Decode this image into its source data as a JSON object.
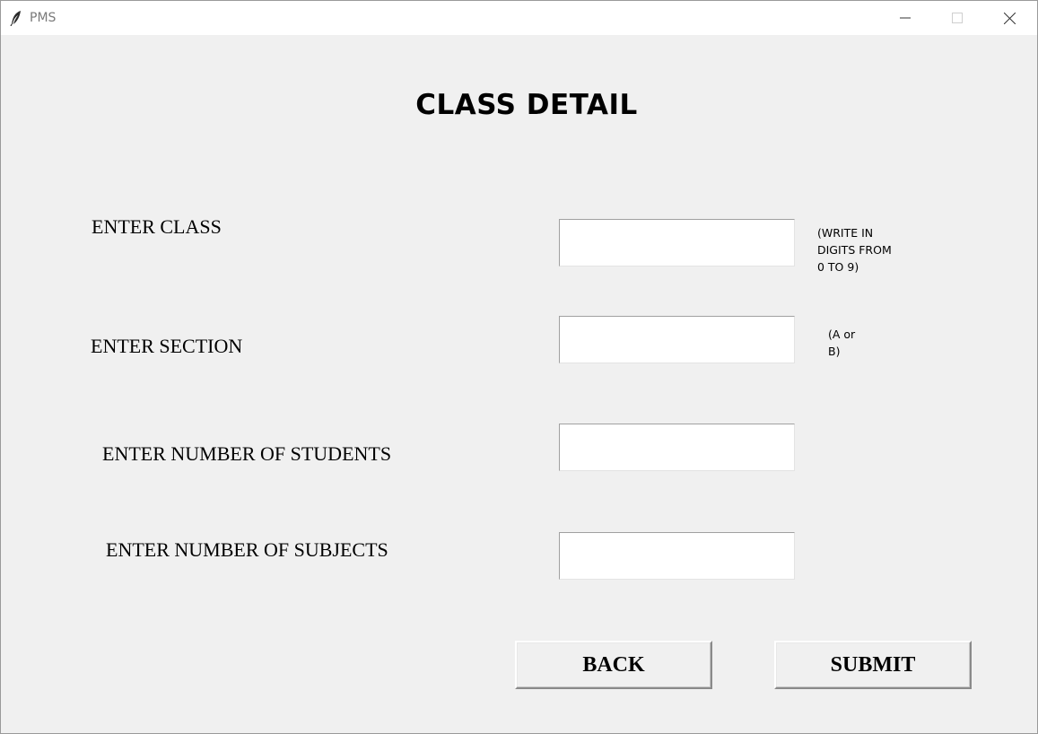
{
  "window": {
    "title": "PMS",
    "icon": "feather-icon"
  },
  "form": {
    "heading": "CLASS DETAIL",
    "fields": [
      {
        "label": "ENTER CLASS",
        "value": "",
        "hint": "(WRITE IN\nDIGITS FROM\n0 TO 9)"
      },
      {
        "label": "ENTER SECTION",
        "value": "",
        "hint": "(A or\nB)"
      },
      {
        "label": "ENTER NUMBER OF STUDENTS",
        "value": ""
      },
      {
        "label": "ENTER NUMBER OF SUBJECTS",
        "value": ""
      }
    ],
    "buttons": {
      "back": "BACK",
      "submit": "SUBMIT"
    }
  }
}
